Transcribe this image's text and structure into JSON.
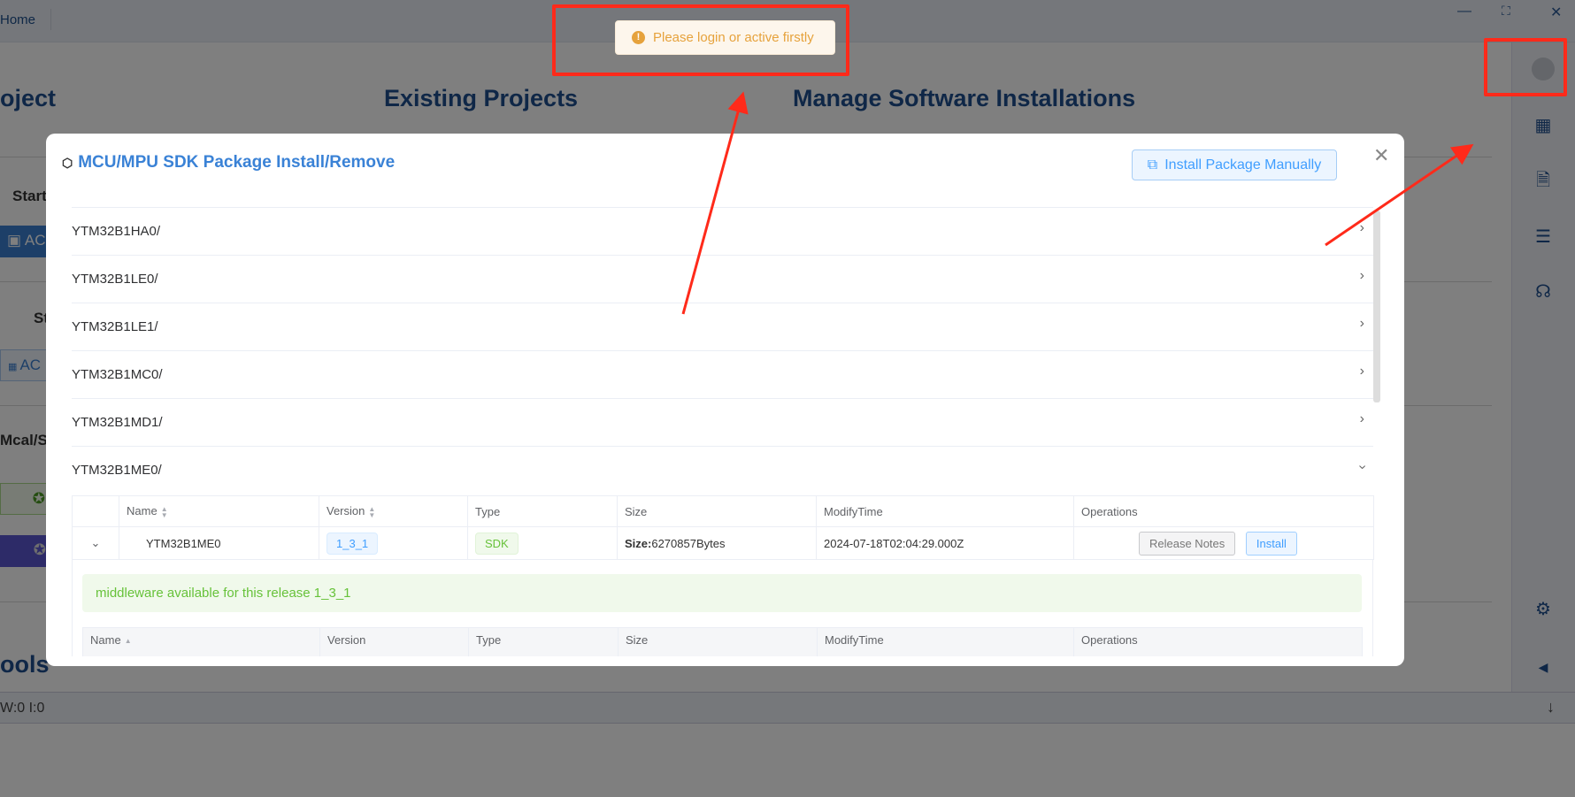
{
  "titlebar": {
    "home": "Home",
    "minimize_icon": "minimize-icon",
    "maximize_icon": "maximize-icon",
    "close_icon": "close-icon"
  },
  "background": {
    "headings": [
      "oject",
      "Existing Projects",
      "Manage Software Installations",
      "ools"
    ],
    "section_labels": [
      "Start",
      "St",
      "Mcal/Sl"
    ],
    "button_fragments": [
      "AC",
      "AC"
    ],
    "colors": {
      "primary": "#3a7fd0",
      "green": "#67c23a",
      "purple": "#5a56d0"
    }
  },
  "right_sidebar": {
    "icons": [
      "avatar",
      "grid-icon",
      "document-icon",
      "sliders-icon",
      "headset-icon",
      "gear-icon",
      "collapse-left-icon"
    ]
  },
  "status_bar": {
    "text": "W:0 I:0",
    "scroll_down_icon": "arrow-down-icon"
  },
  "modal": {
    "title": "MCU/MPU SDK Package Install/Remove",
    "install_manually": "Install Package Manually",
    "packages": [
      {
        "name": "YTM32B1HA0/",
        "expanded": false
      },
      {
        "name": "YTM32B1LE0/",
        "expanded": false
      },
      {
        "name": "YTM32B1LE1/",
        "expanded": false
      },
      {
        "name": "YTM32B1MC0/",
        "expanded": false
      },
      {
        "name": "YTM32B1MD1/",
        "expanded": false
      },
      {
        "name": "YTM32B1ME0/",
        "expanded": true
      }
    ],
    "table": {
      "headers": [
        "Name",
        "Version",
        "Type",
        "Size",
        "ModifyTime",
        "Operations"
      ],
      "rows": [
        {
          "name": "YTM32B1ME0",
          "version": "1_3_1",
          "type": "SDK",
          "size_label": "Size:",
          "size": "6270857Bytes",
          "modify_time": "2024-07-18T02:04:29.000Z",
          "release_notes": "Release Notes",
          "install": "Install"
        }
      ]
    },
    "middleware_alert": "middleware available for this release 1_3_1",
    "sub_table_headers": [
      "Name",
      "Version",
      "Type",
      "Size",
      "ModifyTime",
      "Operations"
    ]
  },
  "toast": {
    "message": "Please login or active firstly",
    "type": "warning",
    "color": "#e6a23c"
  },
  "annotations": {
    "color": "#ff2a1a"
  }
}
